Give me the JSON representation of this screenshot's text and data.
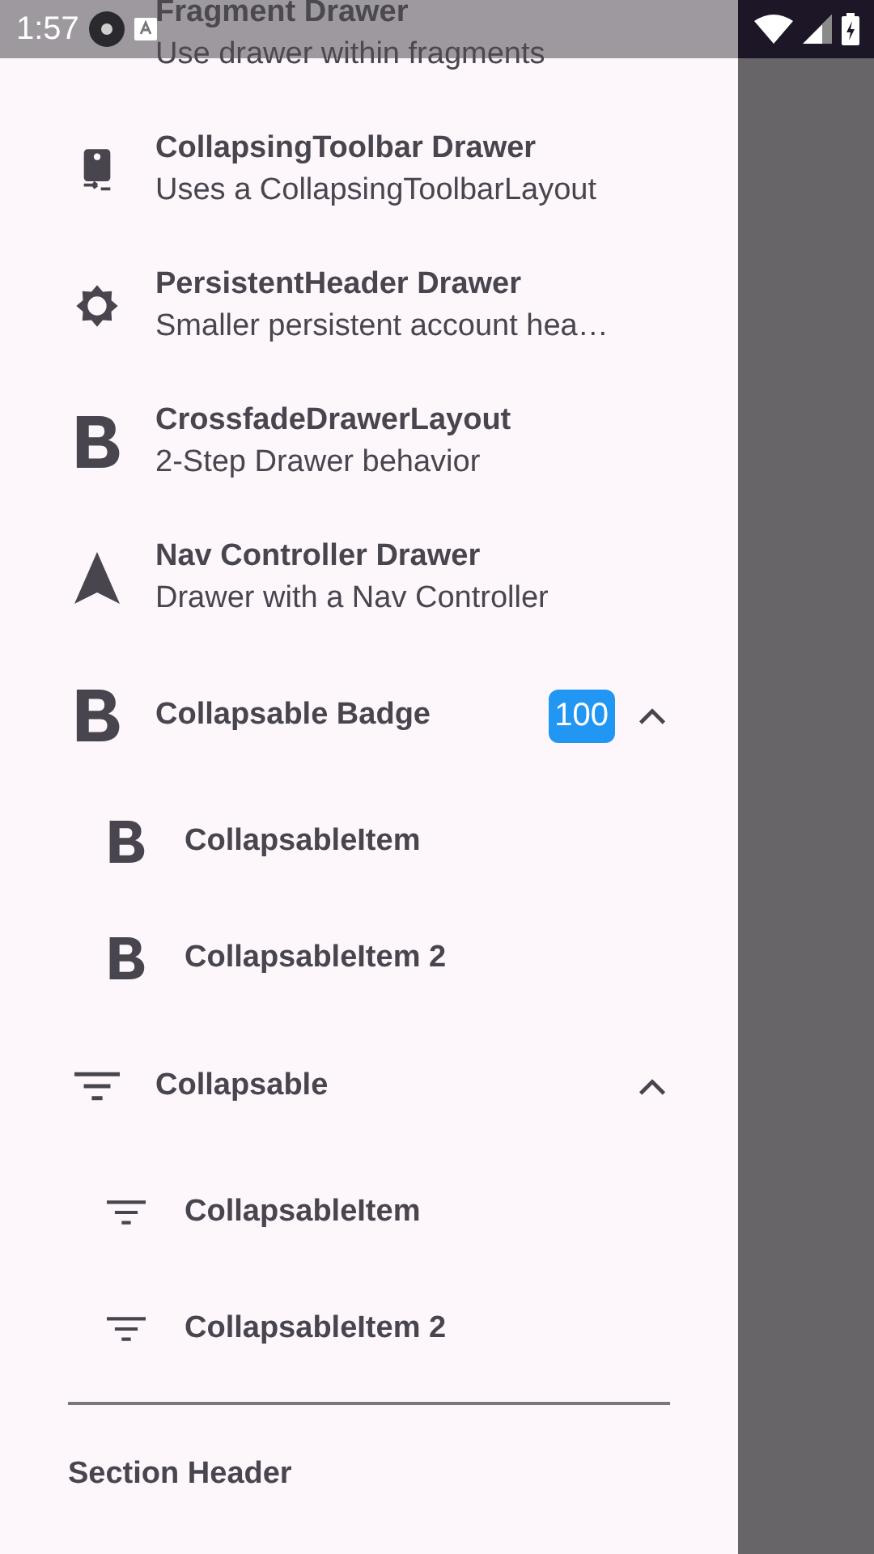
{
  "status_bar": {
    "time": "1:57"
  },
  "drawer": {
    "items": [
      {
        "kind": "two_line",
        "title": "Fragment Drawer",
        "subtitle": "Use drawer within fragments"
      },
      {
        "kind": "two_line",
        "title": "CollapsingToolbar Drawer",
        "subtitle": "Uses a CollapsingToolbarLayout"
      },
      {
        "kind": "two_line",
        "title": "PersistentHeader Drawer",
        "subtitle": "Smaller persistent account hea…"
      },
      {
        "kind": "two_line",
        "title": "CrossfadeDrawerLayout",
        "subtitle": "2-Step Drawer behavior"
      },
      {
        "kind": "two_line",
        "title": "Nav Controller Drawer",
        "subtitle": "Drawer with a Nav Controller"
      },
      {
        "kind": "expandable",
        "title": "Collapsable Badge",
        "badge": "100",
        "expanded": true,
        "children": [
          {
            "title": "CollapsableItem"
          },
          {
            "title": "CollapsableItem 2"
          }
        ]
      },
      {
        "kind": "expandable",
        "title": "Collapsable",
        "expanded": true,
        "children": [
          {
            "title": "CollapsableItem"
          },
          {
            "title": "CollapsableItem 2"
          }
        ]
      },
      {
        "kind": "divider"
      },
      {
        "kind": "section_header",
        "title": "Section Header"
      }
    ]
  }
}
